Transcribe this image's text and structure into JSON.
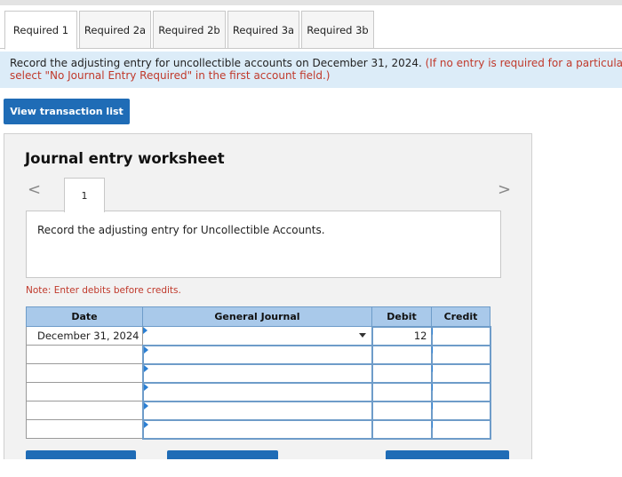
{
  "tabs": [
    {
      "label": "Required 1",
      "active": true
    },
    {
      "label": "Required 2a",
      "active": false
    },
    {
      "label": "Required 2b",
      "active": false
    },
    {
      "label": "Required 3a",
      "active": false
    },
    {
      "label": "Required 3b",
      "active": false
    }
  ],
  "instruction": {
    "main": "Record the adjusting entry for uncollectible accounts on December 31, 2024.",
    "note_line1": "(If no entry is required for a particular t",
    "note_line2": "select \"No Journal Entry Required\" in the first account field.)"
  },
  "view_transaction_button": "View transaction list",
  "worksheet": {
    "title": "Journal entry worksheet",
    "page_number": "1",
    "prev_arrow": "<",
    "next_arrow": ">",
    "description": "Record the adjusting entry for Uncollectible Accounts.",
    "note": "Note: Enter debits before credits.",
    "table": {
      "headers": {
        "date": "Date",
        "general_journal": "General Journal",
        "debit": "Debit",
        "credit": "Credit"
      },
      "rows": [
        {
          "date": "December 31, 2024",
          "account": "",
          "debit": "12",
          "credit": ""
        },
        {
          "date": "",
          "account": "",
          "debit": "",
          "credit": ""
        },
        {
          "date": "",
          "account": "",
          "debit": "",
          "credit": ""
        },
        {
          "date": "",
          "account": "",
          "debit": "",
          "credit": ""
        },
        {
          "date": "",
          "account": "",
          "debit": "",
          "credit": ""
        },
        {
          "date": "",
          "account": "",
          "debit": "",
          "credit": ""
        }
      ]
    }
  },
  "colors": {
    "accent": "#1f6cb6",
    "instruction_bg": "#dcecf8",
    "header_bg": "#a9c9ea",
    "note_red": "#c0392b"
  }
}
